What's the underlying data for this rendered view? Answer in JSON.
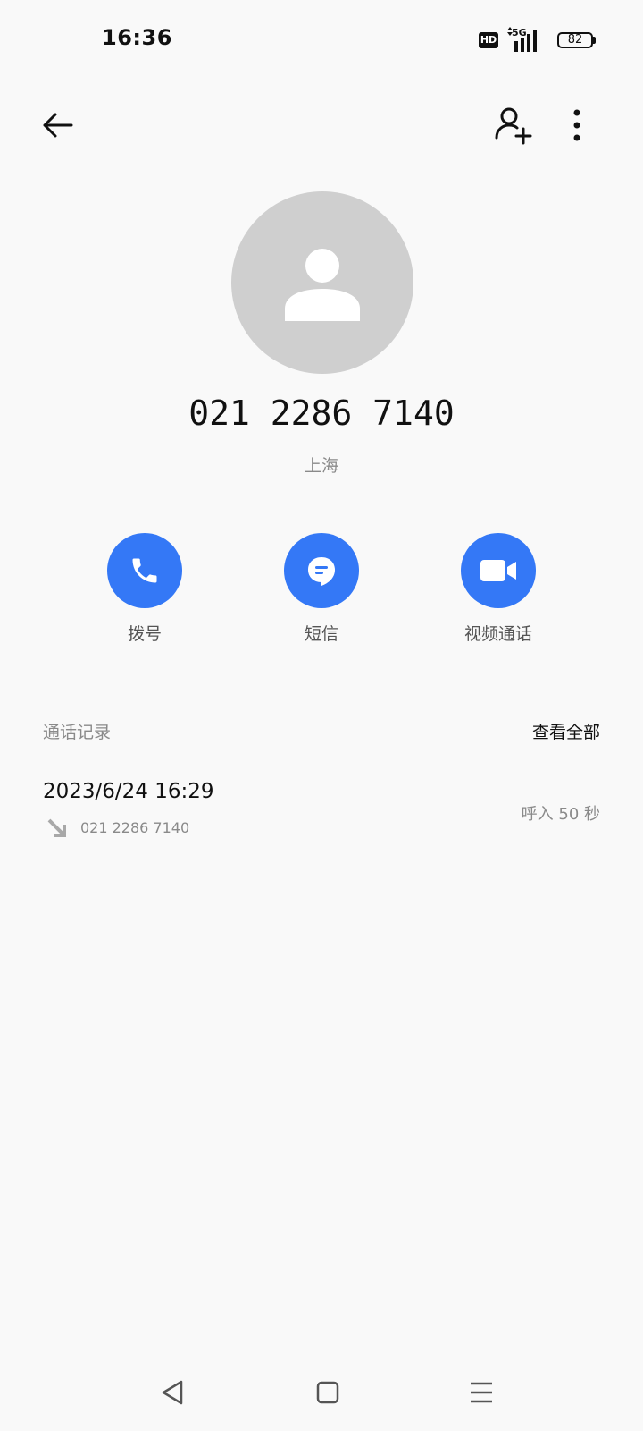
{
  "status_bar": {
    "time": "16:36",
    "hd_badge": "HD",
    "network": "5G",
    "battery": "82"
  },
  "top_bar": {
    "back_icon": "arrow-left-icon",
    "add_contact_icon": "person-add-icon",
    "more_icon": "more-vertical-icon"
  },
  "contact": {
    "avatar_icon": "person-icon",
    "number": "021 2286 7140",
    "location": "上海"
  },
  "actions": [
    {
      "label": "拨号",
      "icon": "phone-icon"
    },
    {
      "label": "短信",
      "icon": "message-icon"
    },
    {
      "label": "视频通话",
      "icon": "video-icon"
    }
  ],
  "call_log": {
    "title": "通话记录",
    "view_all": "查看全部",
    "entries": [
      {
        "datetime": "2023/6/24 16:29",
        "number": "021 2286 7140",
        "type_duration": "呼入 50 秒",
        "direction_icon": "incoming-arrow-icon"
      }
    ]
  },
  "colors": {
    "accent": "#3478f6",
    "avatar_bg": "#cfcfcf",
    "background": "#f9f9f9"
  }
}
